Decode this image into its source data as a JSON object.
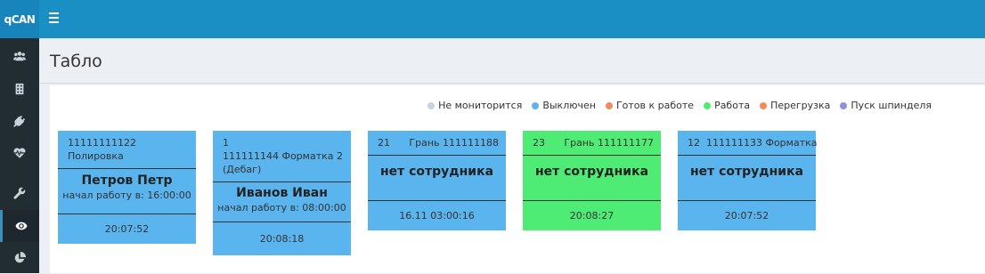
{
  "app": {
    "logo": "qCAN"
  },
  "header": {
    "title": "Табло"
  },
  "legend": [
    {
      "label": "Не мониторится",
      "color": "#c6d4e0"
    },
    {
      "label": "Выключен",
      "color": "#5ab4ee"
    },
    {
      "label": "Готов к работе",
      "color": "#ef8d5a"
    },
    {
      "label": "Работа",
      "color": "#4fec75"
    },
    {
      "label": "Перегрузка",
      "color": "#ef8d5a"
    },
    {
      "label": "Пуск шпинделя",
      "color": "#8e8fe0"
    }
  ],
  "cards": [
    {
      "head_left": "11111111122 Полировка",
      "name": "Петров Петр",
      "sub": "начал работу в: 16:00:00",
      "time": "20:07:52",
      "status_color": "#5ab4ee"
    },
    {
      "head_left": "1",
      "head_line2": "111111144 Форматка 2",
      "head_line3": "(Дебаг)",
      "name": "Иванов Иван",
      "sub": "начал работу в: 08:00:00",
      "time": "20:08:18",
      "status_color": "#5ab4ee"
    },
    {
      "head_left": "21",
      "head_right": "Грань 111111188",
      "name": "нет сотрудника",
      "time": "16.11 03:00:16",
      "status_color": "#5ab4ee"
    },
    {
      "head_left": "23",
      "head_right": "Грань 111111177",
      "name": "нет сотрудника",
      "time": "20:08:27",
      "status_color": "#4fec75"
    },
    {
      "head_left": "12  111111133 Форматка",
      "name": "нет сотрудника",
      "time": "20:07:52",
      "status_color": "#5ab4ee"
    }
  ],
  "sidebar": {
    "items": [
      {
        "icon": "users-icon"
      },
      {
        "icon": "building-icon"
      },
      {
        "icon": "plug-icon"
      },
      {
        "icon": "heartbeat-icon"
      },
      {
        "icon": "wrench-icon"
      },
      {
        "icon": "eye-icon",
        "active": true
      },
      {
        "icon": "pie-chart-icon"
      }
    ]
  }
}
